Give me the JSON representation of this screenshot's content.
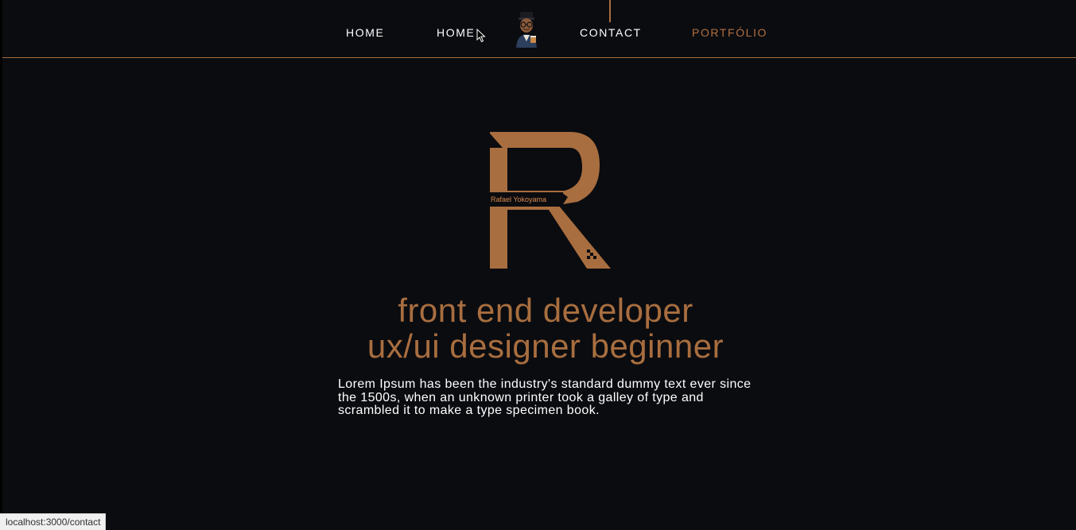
{
  "nav": {
    "items": [
      {
        "label": "HOME"
      },
      {
        "label": "HOME"
      },
      {
        "label": "CONTACT"
      },
      {
        "label": "PORTFÓLIO",
        "active": true
      }
    ],
    "avatar_icon": "memoji-avatar-icon"
  },
  "logo": {
    "letter": "R",
    "label": "Rafael Yokoyama"
  },
  "hero": {
    "title_line1": "front end developer",
    "title_line2": "ux/ui designer beginner",
    "description": "Lorem Ipsum has been the industry's standard dummy text ever since the 1500s, when an unknown printer took a galley of type and scrambled it to make a type specimen book."
  },
  "status_bar": {
    "url": "localhost:3000/contact"
  },
  "colors": {
    "background": "#0b0c10",
    "accent": "#a86e3f",
    "text": "#ffffff"
  }
}
